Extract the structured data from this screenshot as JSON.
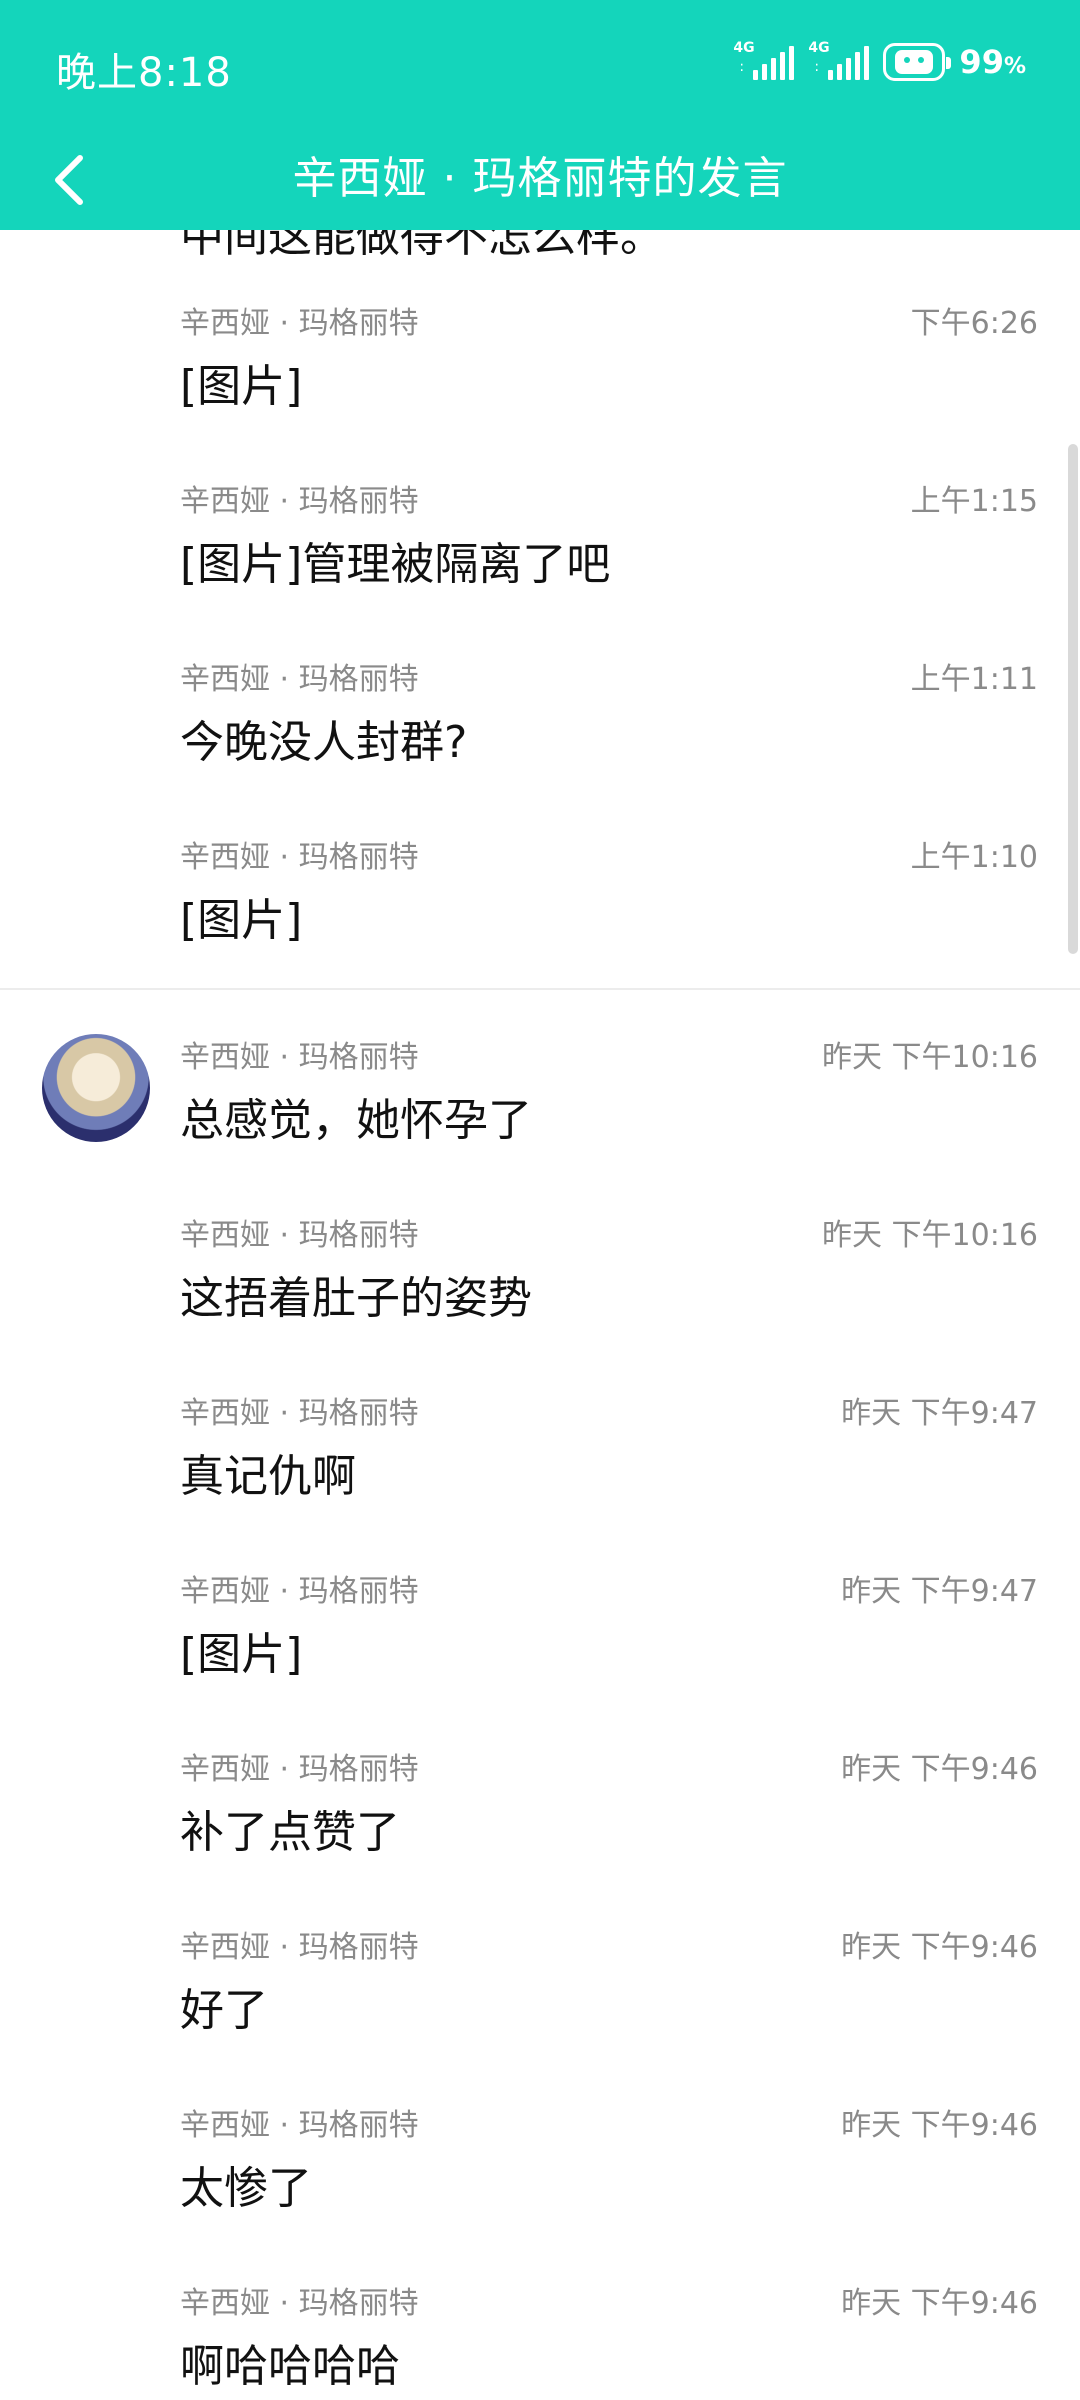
{
  "status_bar": {
    "time": "晚上8:18",
    "network_1": "4G",
    "network_2": "4G",
    "battery_percent": "99",
    "battery_unit": "%"
  },
  "nav": {
    "title": "辛西娅 · 玛格丽特的发言"
  },
  "partial_message_text": "中间这能做得不怎么样。",
  "messages": [
    {
      "name": "辛西娅 · 玛格丽特",
      "time": "下午6:26",
      "text": "[图片]"
    },
    {
      "name": "辛西娅 · 玛格丽特",
      "time": "上午1:15",
      "text": "[图片]管理被隔离了吧"
    },
    {
      "name": "辛西娅 · 玛格丽特",
      "time": "上午1:11",
      "text": "今晚没人封群?"
    },
    {
      "name": "辛西娅 · 玛格丽特",
      "time": "上午1:10",
      "text": "[图片]"
    },
    {
      "name": "辛西娅 · 玛格丽特",
      "time": "昨天 下午10:16",
      "text": "总感觉，她怀孕了"
    },
    {
      "name": "辛西娅 · 玛格丽特",
      "time": "昨天 下午10:16",
      "text": "这捂着肚子的姿势"
    },
    {
      "name": "辛西娅 · 玛格丽特",
      "time": "昨天 下午9:47",
      "text": "真记仇啊"
    },
    {
      "name": "辛西娅 · 玛格丽特",
      "time": "昨天 下午9:47",
      "text": "[图片]"
    },
    {
      "name": "辛西娅 · 玛格丽特",
      "time": "昨天 下午9:46",
      "text": "补了点赞了"
    },
    {
      "name": "辛西娅 · 玛格丽特",
      "time": "昨天 下午9:46",
      "text": "好了"
    },
    {
      "name": "辛西娅 · 玛格丽特",
      "time": "昨天 下午9:46",
      "text": "太惨了"
    },
    {
      "name": "辛西娅 · 玛格丽特",
      "time": "昨天 下午9:46",
      "text": "啊哈哈哈哈"
    }
  ]
}
